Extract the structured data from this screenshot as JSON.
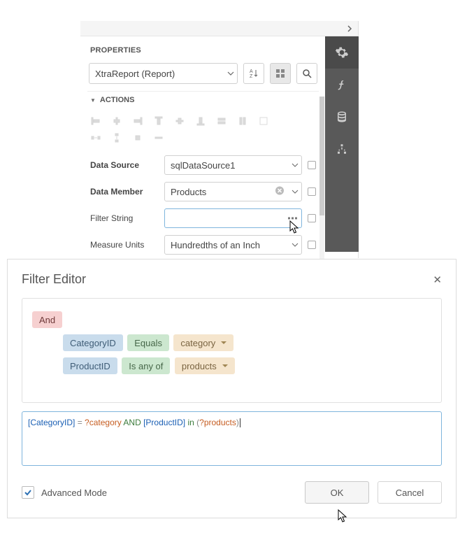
{
  "properties": {
    "header": "PROPERTIES",
    "object": "XtraReport (Report)",
    "actions_header": "ACTIONS",
    "fields": {
      "data_source": {
        "label": "Data Source",
        "value": "sqlDataSource1"
      },
      "data_member": {
        "label": "Data Member",
        "value": "Products"
      },
      "filter_string": {
        "label": "Filter String",
        "value": ""
      },
      "measure_units": {
        "label": "Measure Units",
        "value": "Hundredths of an Inch"
      }
    }
  },
  "sidebar": {
    "items": [
      {
        "name": "gear-icon"
      },
      {
        "name": "fx-icon"
      },
      {
        "name": "database-icon"
      },
      {
        "name": "tree-icon"
      }
    ]
  },
  "filter_editor": {
    "title": "Filter Editor",
    "group_op": "And",
    "conditions": [
      {
        "field": "CategoryID",
        "op": "Equals",
        "value": "category"
      },
      {
        "field": "ProductID",
        "op": "Is any of",
        "value": "products"
      }
    ],
    "expression": {
      "parts": [
        {
          "t": "field",
          "v": "[CategoryID]"
        },
        {
          "t": "op",
          "v": " = "
        },
        {
          "t": "param",
          "v": "?category"
        },
        {
          "t": "kw",
          "v": " AND "
        },
        {
          "t": "field",
          "v": "[ProductID]"
        },
        {
          "t": "kw",
          "v": " in "
        },
        {
          "t": "op",
          "v": "("
        },
        {
          "t": "param",
          "v": "?products"
        },
        {
          "t": "op",
          "v": ")"
        }
      ]
    },
    "advanced_mode": {
      "label": "Advanced Mode",
      "checked": true
    },
    "ok": "OK",
    "cancel": "Cancel"
  }
}
